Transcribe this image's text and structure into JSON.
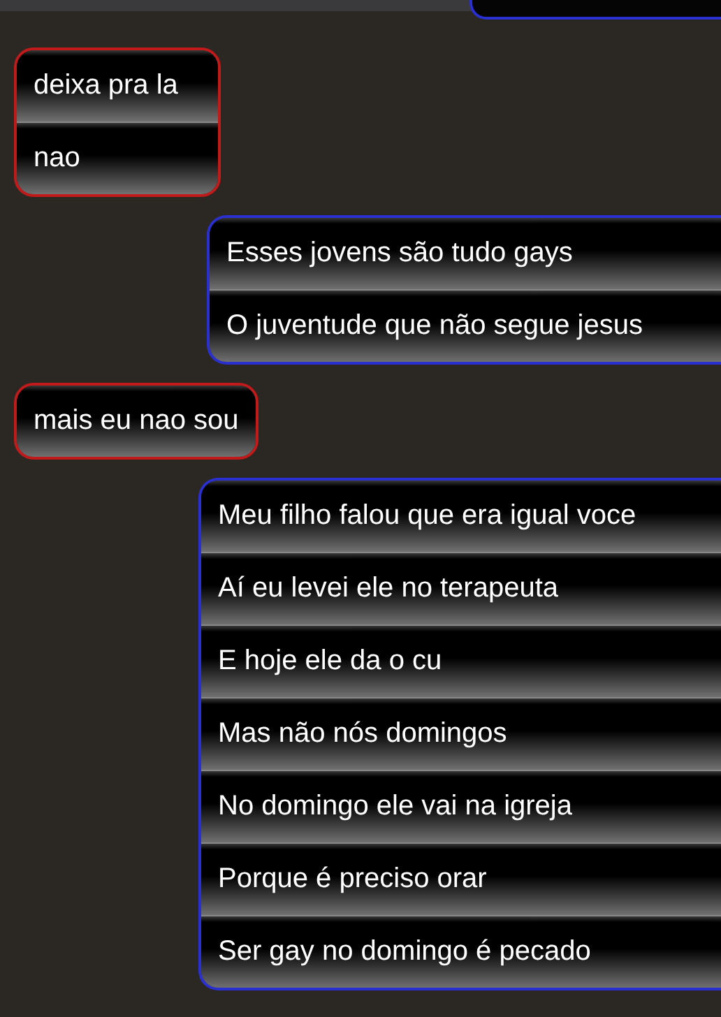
{
  "messages": [
    {
      "kind": "incoming",
      "lines": [
        "deixa pra la",
        "nao"
      ]
    },
    {
      "kind": "outgoing",
      "lines": [
        "Esses jovens são tudo gays",
        "O juventude que não segue jesus"
      ]
    },
    {
      "kind": "incoming",
      "lines": [
        "mais eu nao sou"
      ]
    },
    {
      "kind": "outgoing",
      "lines": [
        "Meu filho falou que era igual voce",
        "Aí eu levei ele no terapeuta",
        "E hoje ele da o cu",
        "Mas não nós domingos",
        "No domingo ele vai na igreja",
        "Porque é preciso orar",
        "Ser gay no domingo é pecado"
      ]
    }
  ]
}
